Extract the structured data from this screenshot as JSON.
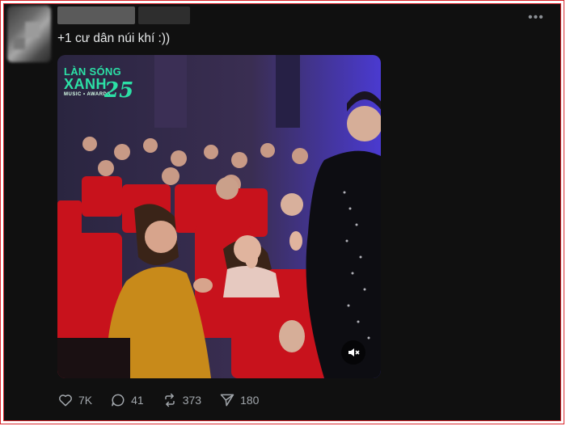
{
  "post": {
    "caption": "+1 cư dân núi khí :))",
    "more_icon": "more-dots-icon"
  },
  "media": {
    "logo": {
      "line1": "LÀN SÓNG",
      "line2": "XANH",
      "line3": "MUSIC • AWARDS",
      "number": "25"
    },
    "mute_icon": "speaker-muted-icon"
  },
  "actions": {
    "likes": "7K",
    "replies": "41",
    "reposts": "373",
    "shares": "180"
  },
  "colors": {
    "background": "#101010",
    "text": "#e7e9ea",
    "muted": "#a1a6ab",
    "border": "#d9262c",
    "logo": "#2ce0a6"
  }
}
